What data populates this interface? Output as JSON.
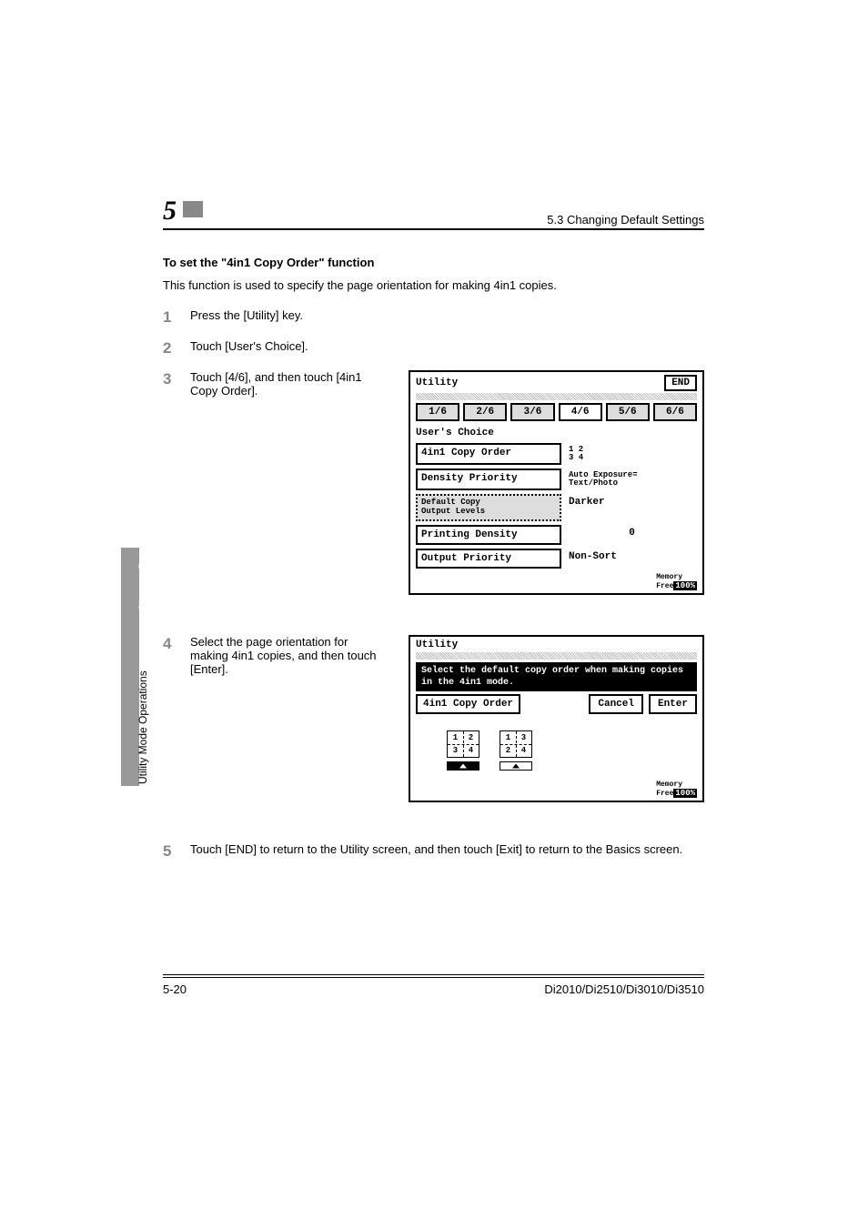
{
  "header": {
    "chapter_num": "5",
    "section": "5.3 Changing Default Settings"
  },
  "section": {
    "title": "To set the \"4in1 Copy Order\" function",
    "desc": "This function is used to specify the page orientation for making 4in1 copies."
  },
  "steps": {
    "s1": {
      "num": "1",
      "text": "Press the [Utility] key."
    },
    "s2": {
      "num": "2",
      "text": "Touch [User's Choice]."
    },
    "s3": {
      "num": "3",
      "text": "Touch [4/6], and then touch [4in1 Copy Order]."
    },
    "s4": {
      "num": "4",
      "text": "Select the page orientation for making 4in1 copies, and then touch [Enter]."
    },
    "s5": {
      "num": "5",
      "text": "Touch [END] to return to the Utility screen, and then touch [Exit] to return to the Basics screen."
    }
  },
  "panel1": {
    "title": "Utility",
    "end": "END",
    "tabs": [
      "1/6",
      "2/6",
      "3/6",
      "4/6",
      "5/6",
      "6/6"
    ],
    "subhead": "User's Choice",
    "rows": [
      {
        "label": "4in1 Copy Order",
        "value": "1 2\n3 4"
      },
      {
        "label": "Density Priority",
        "value": "Auto Exposure=\nText/Photo"
      },
      {
        "label": "Default Copy\nOutput Levels",
        "value": "Darker"
      },
      {
        "label": "Printing Density",
        "value": "0"
      },
      {
        "label": "Output Priority",
        "value": "Non-Sort"
      }
    ],
    "mem_label": "Memory\nFree",
    "mem_val": "100%"
  },
  "panel2": {
    "title": "Utility",
    "banner": "Select the default copy order when making copies in the 4in1 mode.",
    "left_btn": "4in1 Copy Order",
    "cancel": "Cancel",
    "enter": "Enter",
    "grids": [
      [
        "1",
        "2",
        "3",
        "4"
      ],
      [
        "1",
        "3",
        "2",
        "4"
      ]
    ],
    "mem_label": "Memory\nFree",
    "mem_val": "100%"
  },
  "side": {
    "chapter": "Chapter 5",
    "mode": "Utility Mode Operations"
  },
  "footer": {
    "page": "5-20",
    "model": "Di2010/Di2510/Di3010/Di3510"
  }
}
